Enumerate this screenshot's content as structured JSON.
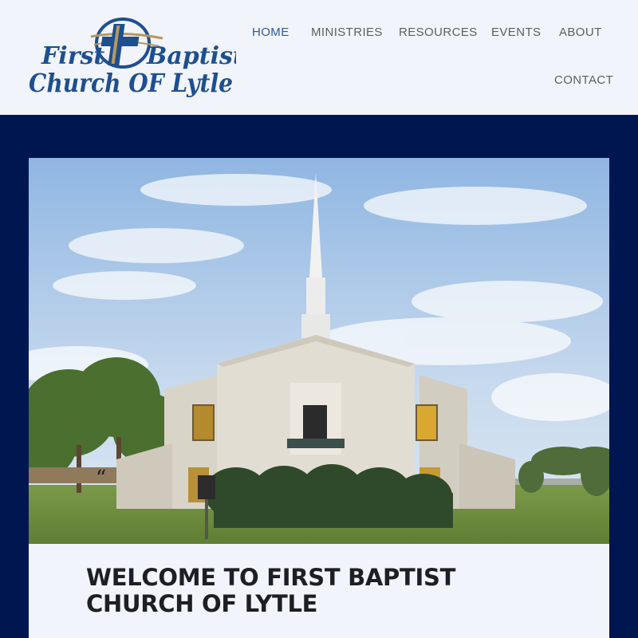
{
  "logo": {
    "line1_left": "First",
    "line1_right": "Baptist",
    "line2": "Church OF Lytle",
    "colors": {
      "navy": "#1e4f8f",
      "gold": "#b8985a"
    }
  },
  "nav": {
    "items": [
      {
        "label": "HOME",
        "active": true
      },
      {
        "label": "MINISTRIES",
        "active": false
      },
      {
        "label": "RESOURCES",
        "active": false
      },
      {
        "label": "EVENTS",
        "active": false
      },
      {
        "label": "ABOUT",
        "active": false
      },
      {
        "label": "CONTACT",
        "active": false
      }
    ]
  },
  "hero": {
    "image": "church-building-photo"
  },
  "main": {
    "title": "WELCOME TO FIRST BAPTIST CHURCH OF LYTLE",
    "quote_mark": "“"
  },
  "colors": {
    "header_bg": "#f1f4fa",
    "band_bg": "#001650",
    "nav_active": "#2e5a9c",
    "nav_text": "#5a5f66"
  }
}
